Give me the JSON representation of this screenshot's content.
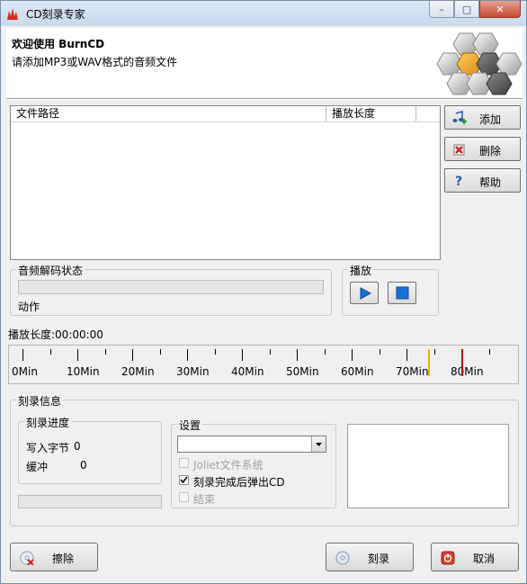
{
  "window": {
    "title": "CD刻录专家",
    "minimize_glyph": "–",
    "maximize_glyph": "▢",
    "close_glyph": "✕"
  },
  "header": {
    "title": "欢迎使用 BurnCD",
    "subtitle": "请添加MP3或WAV格式的音频文件"
  },
  "file_list": {
    "columns": [
      "文件路径",
      "播放长度"
    ],
    "rows": []
  },
  "side_buttons": {
    "add_label": "添加",
    "delete_label": "删除",
    "help_label": "帮助"
  },
  "decode_status": {
    "group_label": "音频解码状态",
    "action_label": "动作"
  },
  "playback": {
    "group_label": "播放"
  },
  "play_length": {
    "label": "播放长度:00:00:00"
  },
  "ruler": {
    "tick_labels": [
      "0Min",
      "10Min",
      "20Min",
      "30Min",
      "40Min",
      "50Min",
      "60Min",
      "70Min",
      "80Min"
    ],
    "yellow_marker_min": 74,
    "red_marker_min": 80
  },
  "burn_info": {
    "group_label": "刻录信息",
    "progress_group_label": "刻录进度",
    "bytes_written_label": "写入字节",
    "bytes_written_value": "0",
    "buffer_label": "缓冲",
    "buffer_value": "0",
    "progress_fraction": 0
  },
  "settings": {
    "group_label": "设置",
    "drive_selected": "",
    "joliet_label": "Joliet文件系统",
    "joliet_checked": false,
    "eject_label": "刻录完成后弹出CD",
    "eject_checked": true,
    "finalize_label": "结束",
    "finalize_checked": false
  },
  "bottom_buttons": {
    "erase_label": "擦除",
    "burn_label": "刻录",
    "cancel_label": "取消"
  },
  "colors": {
    "yellow_marker": "#e8b400",
    "red_marker": "#c00000",
    "logo_orange": "#e8a020"
  }
}
